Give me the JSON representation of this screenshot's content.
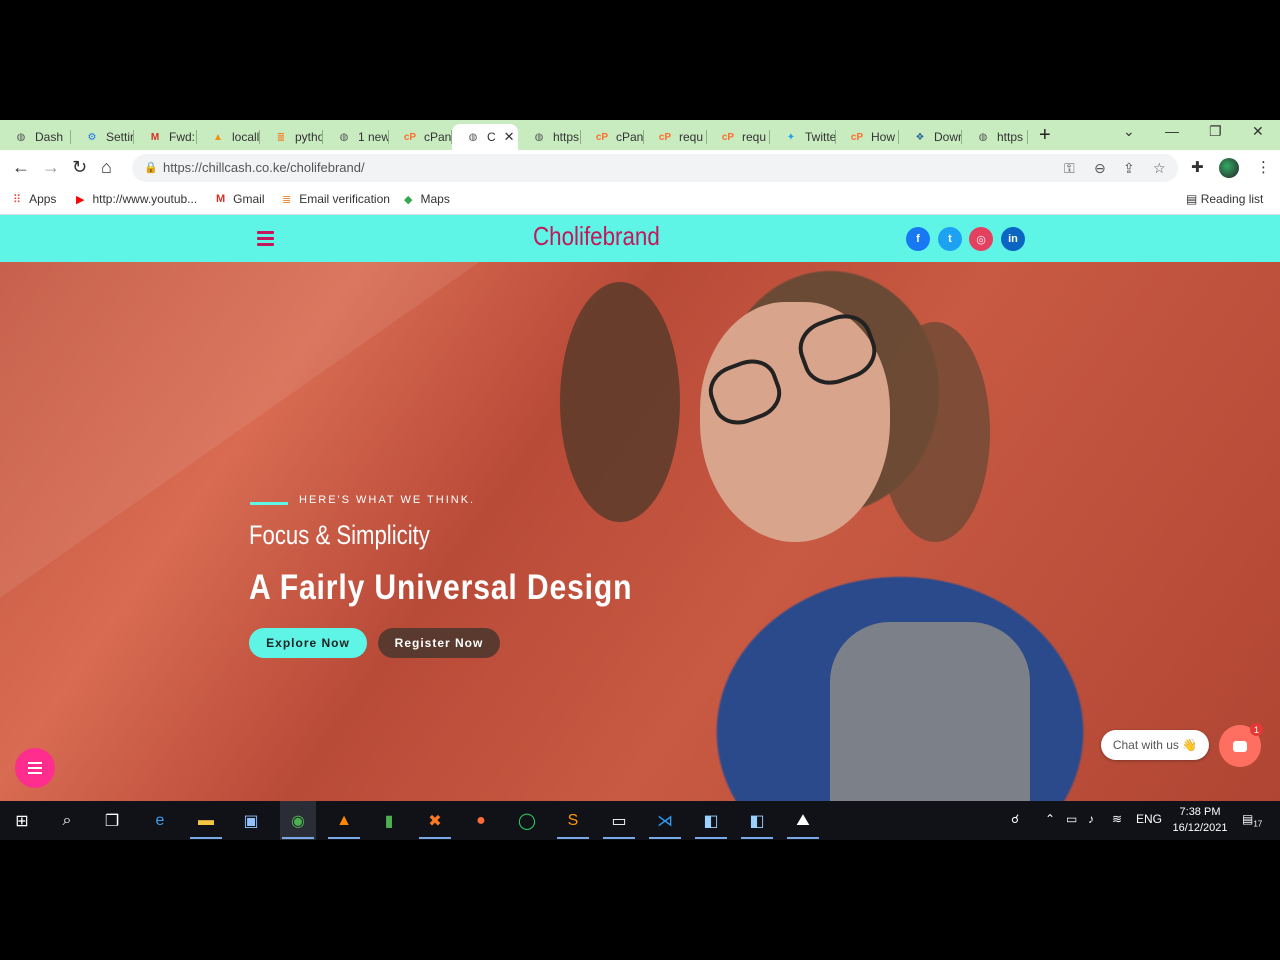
{
  "browser": {
    "tabs": [
      {
        "label": "Dash",
        "icon": "globe-icon",
        "color": "#555"
      },
      {
        "label": "Settir",
        "icon": "gear-icon",
        "color": "#1a73e8"
      },
      {
        "label": "Fwd:",
        "icon": "gmail-icon",
        "color": "#d93025"
      },
      {
        "label": "locall",
        "icon": "phpmyadmin-icon",
        "color": "#f29111"
      },
      {
        "label": "pytho",
        "icon": "stackoverflow-icon",
        "color": "#f48024"
      },
      {
        "label": "1 new",
        "icon": "globe-icon",
        "color": "#555"
      },
      {
        "label": "cPane",
        "icon": "cpanel-icon",
        "color": "#ff6c2c"
      },
      {
        "label": "C",
        "icon": "globe-icon",
        "color": "#555",
        "active": true
      },
      {
        "label": "https",
        "icon": "globe-icon",
        "color": "#555"
      },
      {
        "label": "cPane",
        "icon": "cpanel-icon",
        "color": "#ff6c2c"
      },
      {
        "label": "requ",
        "icon": "cpanel-icon",
        "color": "#ff6c2c"
      },
      {
        "label": "requ",
        "icon": "cpanel-icon",
        "color": "#ff6c2c"
      },
      {
        "label": "Twitte",
        "icon": "twitter-icon",
        "color": "#1da1f2"
      },
      {
        "label": "How",
        "icon": "cpanel-icon",
        "color": "#ff6c2c"
      },
      {
        "label": "Dowr",
        "icon": "python-icon",
        "color": "#306998"
      },
      {
        "label": "https",
        "icon": "globe-icon",
        "color": "#555"
      }
    ],
    "url": "https://chillcash.co.ke/cholifebrand/",
    "bookmarks": [
      {
        "label": "Apps",
        "icon": "apps-grid-icon"
      },
      {
        "label": "http://www.youtub...",
        "icon": "youtube-icon"
      },
      {
        "label": "Gmail",
        "icon": "gmail-icon"
      },
      {
        "label": "Email verification",
        "icon": "stackoverflow-icon"
      },
      {
        "label": "Maps",
        "icon": "maps-icon"
      }
    ],
    "reading_list": "Reading list"
  },
  "site": {
    "brand": "Cholifebrand",
    "social": [
      {
        "name": "facebook",
        "glyph": "f",
        "color": "#1877f2"
      },
      {
        "name": "twitter",
        "glyph": "t",
        "color": "#1da1f2"
      },
      {
        "name": "instagram",
        "glyph": "◎",
        "color": "#e4405f"
      },
      {
        "name": "linkedin",
        "glyph": "in",
        "color": "#0a66c2"
      }
    ],
    "hero": {
      "eyebrow": "HERE'S WHAT WE THINK.",
      "subtitle": "Focus & Simplicity",
      "title": "A Fairly Universal Design",
      "explore": "Explore Now",
      "register": "Register Now"
    },
    "chat": {
      "label": "Chat with us 👋",
      "badge": "1"
    }
  },
  "taskbar": {
    "lang": "ENG",
    "time": "7:38 PM",
    "date": "16/12/2021",
    "notifications": "17"
  }
}
